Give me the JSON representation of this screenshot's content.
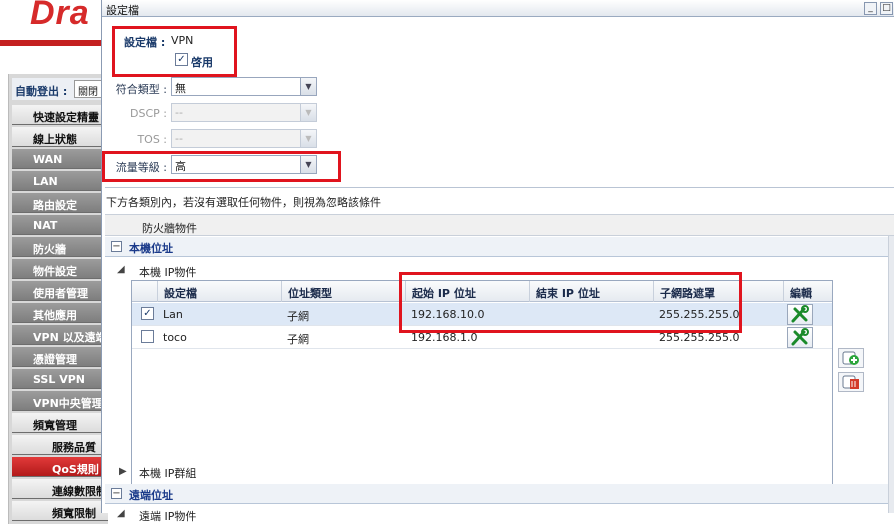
{
  "background": {
    "brand": "Dra",
    "logout": {
      "label": "自動登出 :",
      "value": "關閉"
    },
    "nav": [
      {
        "label": "快速設定精靈",
        "style": "light"
      },
      {
        "label": "線上狀態",
        "style": "light"
      },
      {
        "label": "WAN",
        "style": "dark"
      },
      {
        "label": "LAN",
        "style": "dark"
      },
      {
        "label": "路由設定",
        "style": "dark"
      },
      {
        "label": "NAT",
        "style": "dark"
      },
      {
        "label": "防火牆",
        "style": "dark"
      },
      {
        "label": "物件設定",
        "style": "dark"
      },
      {
        "label": "使用者管理",
        "style": "dark"
      },
      {
        "label": "其他應用",
        "style": "dark"
      },
      {
        "label": "VPN 以及遠端",
        "style": "dark"
      },
      {
        "label": "憑證管理",
        "style": "dark"
      },
      {
        "label": "SSL VPN",
        "style": "dark"
      },
      {
        "label": "VPN中央管理",
        "style": "dark"
      },
      {
        "label": "頻寬管理",
        "style": "light"
      },
      {
        "label": "服務品質",
        "style": "sub"
      },
      {
        "label": "QoS規則",
        "style": "active"
      },
      {
        "label": "連線數限制",
        "style": "sub"
      },
      {
        "label": "頻寬限制",
        "style": "sub"
      }
    ]
  },
  "dialog": {
    "title": "設定檔",
    "minimize_glyph": "_",
    "maximize_glyph": "□",
    "profile": {
      "label": "設定檔 :",
      "value": "VPN"
    },
    "enable": {
      "label": "啓用",
      "checked": true,
      "check_glyph": "✓"
    },
    "match_type": {
      "label": "符合類型 :",
      "value": "無"
    },
    "dscp": {
      "label": "DSCP :",
      "value": "--"
    },
    "tos": {
      "label": "TOS :",
      "value": "--"
    },
    "traffic_class": {
      "label": "流量等級 :",
      "value": "高"
    },
    "dropdown_glyph": "▼",
    "note": "下方各類別內，若沒有選取任何物件，則視為忽略該條件",
    "object_header": "防火牆物件",
    "local_section": {
      "toggle": "−",
      "title": "本機位址"
    },
    "local_ip_object": {
      "toggle": "◢",
      "label": "本機 IP物件"
    },
    "local_ip_group": {
      "toggle": "▶",
      "label": "本機 IP群組"
    },
    "remote_section": {
      "toggle": "−",
      "title": "遠端位址"
    },
    "remote_ip_object": {
      "toggle": "◢",
      "label": "遠端 IP物件"
    },
    "grid": {
      "columns": [
        "設定檔",
        "位址類型",
        "起始 IP 位址",
        "結束 IP 位址",
        "子網路遮罩",
        "編輯"
      ],
      "rows": [
        {
          "checked": true,
          "check": "✓",
          "name": "Lan",
          "type": "子網",
          "start_ip": "192.168.10.0",
          "end_ip": "",
          "mask": "255.255.255.0"
        },
        {
          "checked": false,
          "check": "",
          "name": "toco",
          "type": "子網",
          "start_ip": "192.168.1.0",
          "end_ip": "",
          "mask": "255.255.255.0"
        }
      ]
    },
    "icons": {
      "edit": "wrench-screwdriver-icon",
      "add": "add-object-icon",
      "delete": "delete-object-icon"
    },
    "colors": {
      "highlight": "#e0141e",
      "section_title": "#1a3a8a",
      "selected_row": "#dde8f6"
    }
  }
}
